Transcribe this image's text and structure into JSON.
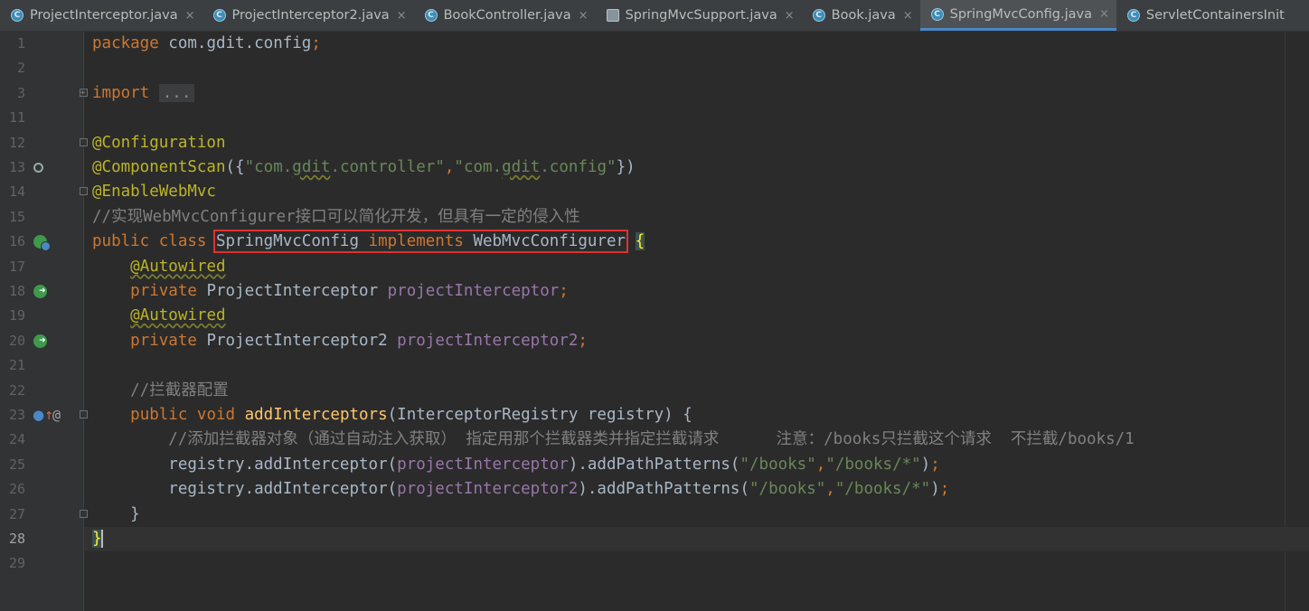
{
  "tabs": [
    {
      "name": "ProjectInterceptor.java",
      "icon": "java-class-icon",
      "active": false
    },
    {
      "name": "ProjectInterceptor2.java",
      "icon": "java-class-icon",
      "active": false
    },
    {
      "name": "BookController.java",
      "icon": "java-class-icon",
      "active": false
    },
    {
      "name": "SpringMvcSupport.java",
      "icon": "java-file-icon",
      "active": false
    },
    {
      "name": "Book.java",
      "icon": "java-class-icon",
      "active": false
    },
    {
      "name": "SpringMvcConfig.java",
      "icon": "java-class-icon",
      "active": true
    },
    {
      "name": "ServletContainersInit",
      "icon": "java-class-icon",
      "active": false
    }
  ],
  "tab_close_glyph": "×",
  "tab_icon_letter": "C",
  "colors": {
    "background": "#2b2b2b",
    "keyword": "#cc7832",
    "annotation": "#bbb529",
    "string": "#6a8759",
    "comment": "#808080",
    "field": "#9876aa",
    "method": "#ffc66d",
    "highlight_box": "#e0312f",
    "active_tab_underline": "#4a88c7"
  },
  "editor": {
    "current_line": "28",
    "lines": [
      {
        "num": "1",
        "tokens": [
          [
            "kw",
            "package "
          ],
          [
            "plain",
            "com.gdit.config"
          ],
          [
            "sem",
            ";"
          ]
        ]
      },
      {
        "num": "2",
        "tokens": []
      },
      {
        "num": "3",
        "fold": "plus",
        "tokens": [
          [
            "kw",
            "import "
          ],
          [
            "folded",
            "..."
          ]
        ]
      },
      {
        "num": "11",
        "tokens": []
      },
      {
        "num": "12",
        "fold": "minus",
        "tokens": [
          [
            "ann",
            "@Configuration"
          ]
        ]
      },
      {
        "num": "13",
        "gicon": "search",
        "tokens": [
          [
            "ann",
            "@ComponentScan"
          ],
          [
            "plain",
            "({"
          ],
          [
            "str",
            "\"com."
          ],
          [
            "str-wavy",
            "gdit"
          ],
          [
            "str",
            ".controller\""
          ],
          [
            "sem",
            ","
          ],
          [
            "str",
            "\"com."
          ],
          [
            "str-wavy",
            "gdit"
          ],
          [
            "str",
            ".config\""
          ],
          [
            "plain",
            "})"
          ]
        ]
      },
      {
        "num": "14",
        "fold": "minus",
        "tokens": [
          [
            "ann",
            "@EnableWebMvc"
          ]
        ]
      },
      {
        "num": "15",
        "tokens": [
          [
            "cmt",
            "//实现WebMvcConfigurer接口可以简化开发，但具有一定的侵入性"
          ]
        ]
      },
      {
        "num": "16",
        "gicon": "bean",
        "tokens": [
          [
            "kw",
            "public class "
          ],
          [
            "box-open",
            ""
          ],
          [
            "plain",
            "SpringMvcConfig "
          ],
          [
            "kw",
            "implements "
          ],
          [
            "plain",
            "WebMvcConfigurer"
          ],
          [
            "box-close",
            ""
          ],
          [
            "plain",
            " "
          ],
          [
            "brace",
            "{"
          ]
        ]
      },
      {
        "num": "17",
        "tokens": [
          [
            "plain",
            "    "
          ],
          [
            "ann-wavy",
            "@Autowired"
          ]
        ]
      },
      {
        "num": "18",
        "gicon": "bean-arrow",
        "tokens": [
          [
            "plain",
            "    "
          ],
          [
            "kw",
            "private "
          ],
          [
            "plain",
            "ProjectInterceptor "
          ],
          [
            "fld",
            "projectInterceptor"
          ],
          [
            "sem",
            ";"
          ]
        ]
      },
      {
        "num": "19",
        "tokens": [
          [
            "plain",
            "    "
          ],
          [
            "ann-wavy",
            "@Autowired"
          ]
        ]
      },
      {
        "num": "20",
        "gicon": "bean-arrow",
        "tokens": [
          [
            "plain",
            "    "
          ],
          [
            "kw",
            "private "
          ],
          [
            "plain",
            "ProjectInterceptor2 "
          ],
          [
            "fld",
            "projectInterceptor2"
          ],
          [
            "sem",
            ";"
          ]
        ]
      },
      {
        "num": "21",
        "tokens": []
      },
      {
        "num": "22",
        "tokens": [
          [
            "plain",
            "    "
          ],
          [
            "cmt",
            "//拦截器配置"
          ]
        ]
      },
      {
        "num": "23",
        "gicon": "override",
        "at": "@",
        "fold": "minus",
        "tokens": [
          [
            "plain",
            "    "
          ],
          [
            "kw",
            "public void "
          ],
          [
            "mth",
            "addInterceptors"
          ],
          [
            "plain",
            "(InterceptorRegistry registry) {"
          ]
        ]
      },
      {
        "num": "24",
        "tokens": [
          [
            "plain",
            "        "
          ],
          [
            "cmt",
            "//添加拦截器对象（通过自动注入获取） 指定用那个拦截器类并指定拦截请求      注意：/books只拦截这个请求  不拦截/books/1"
          ]
        ]
      },
      {
        "num": "25",
        "tokens": [
          [
            "plain",
            "        registry.addInterceptor("
          ],
          [
            "fld",
            "projectInterceptor"
          ],
          [
            "plain",
            ").addPathPatterns("
          ],
          [
            "str",
            "\"/books\""
          ],
          [
            "sem",
            ","
          ],
          [
            "str",
            "\"/books/*\""
          ],
          [
            "plain",
            ")"
          ],
          [
            "sem",
            ";"
          ]
        ]
      },
      {
        "num": "26",
        "tokens": [
          [
            "plain",
            "        registry.addInterceptor("
          ],
          [
            "fld",
            "projectInterceptor2"
          ],
          [
            "plain",
            ").addPathPatterns("
          ],
          [
            "str",
            "\"/books\""
          ],
          [
            "sem",
            ","
          ],
          [
            "str",
            "\"/books/*\""
          ],
          [
            "plain",
            ")"
          ],
          [
            "sem",
            ";"
          ]
        ]
      },
      {
        "num": "27",
        "fold": "minus",
        "tokens": [
          [
            "plain",
            "    }"
          ]
        ]
      },
      {
        "num": "28",
        "tokens": [
          [
            "brace",
            "}"
          ],
          [
            "caret",
            ""
          ]
        ]
      },
      {
        "num": "29",
        "tokens": []
      }
    ]
  }
}
